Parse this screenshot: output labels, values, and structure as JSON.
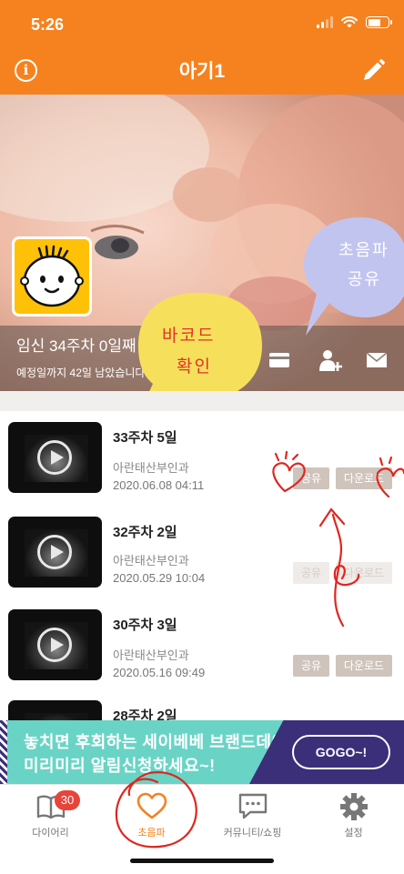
{
  "status_bar": {
    "time": "5:26"
  },
  "header": {
    "title": "아기1",
    "info_icon": "info-icon",
    "edit_icon": "pencil-icon"
  },
  "hero": {
    "week_text": "임신 34주차 0일째",
    "due_text": "예정일까지 42일 남았습니다",
    "avatar_icon": "baby-face-icon",
    "actions": [
      "card-icon",
      "add-user-icon",
      "mail-icon"
    ],
    "bubble_barcode": [
      "바코드",
      "확인"
    ],
    "bubble_share": [
      "초음파",
      "공유"
    ]
  },
  "list": {
    "share_label": "공유",
    "download_label": "다운로드",
    "items": [
      {
        "week": "33주차 5일",
        "clinic": "아란태산부인과",
        "date": "2020.06.08 04:11",
        "buttons_enabled": true
      },
      {
        "week": "32주차 2일",
        "clinic": "아란태산부인과",
        "date": "2020.05.29 10:04",
        "buttons_enabled": false
      },
      {
        "week": "30주차 3일",
        "clinic": "아란태산부인과",
        "date": "2020.05.16 09:49",
        "buttons_enabled": true
      },
      {
        "week": "28주차 2일",
        "clinic": "",
        "date": "",
        "buttons_enabled": true
      }
    ]
  },
  "banner": {
    "line1": "놓치면 후회하는 세이베베 브랜드데이",
    "line2": "미리미리 알림신청하세요~!",
    "cta": "GOGO~!"
  },
  "tabbar": {
    "tabs": [
      {
        "label": "다이어리",
        "icon": "book-icon",
        "badge": "30"
      },
      {
        "label": "초음파",
        "icon": "heart-icon",
        "active": true
      },
      {
        "label": "커뮤니티/쇼핑",
        "icon": "chat-bubble-icon"
      },
      {
        "label": "설정",
        "icon": "gear-icon"
      }
    ]
  },
  "colors": {
    "brand_orange": "#f5821f",
    "badge_red": "#e8443a",
    "banner_teal": "#69d4c6",
    "banner_purple": "#3b2f7a"
  }
}
